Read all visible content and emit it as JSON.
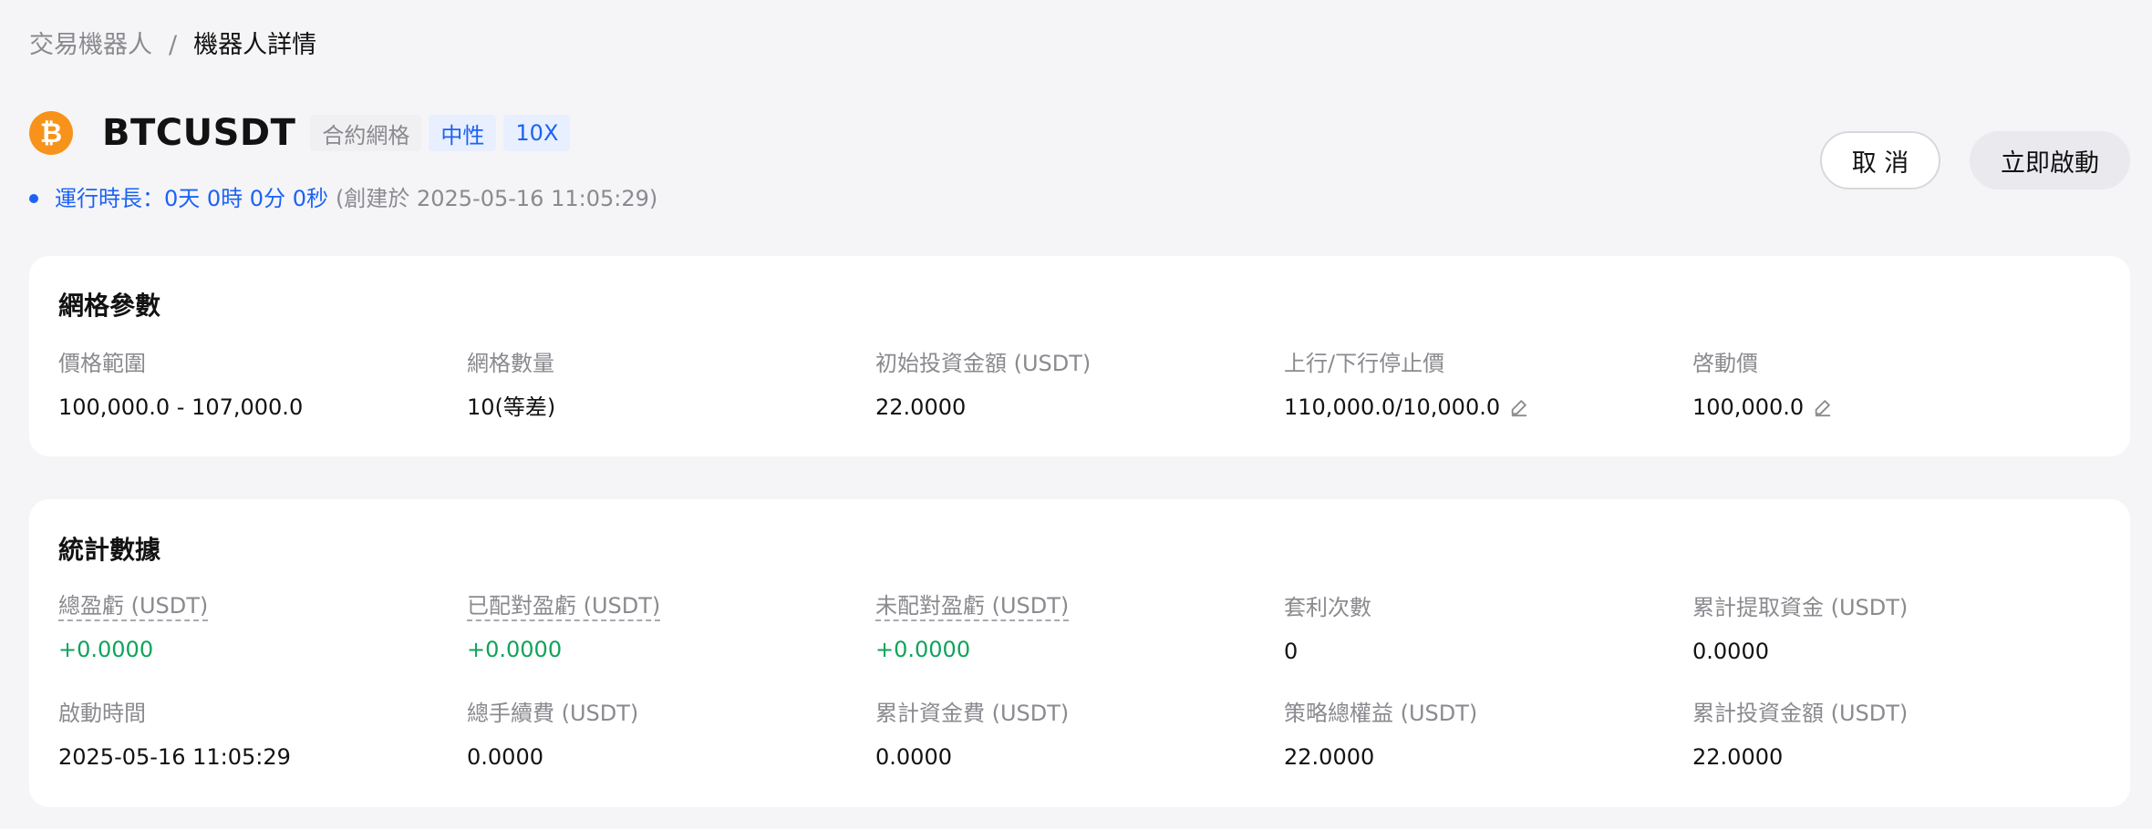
{
  "breadcrumb": {
    "parent": "交易機器人",
    "separator": "/",
    "current": "機器人詳情"
  },
  "header": {
    "coin_glyph": "₿",
    "symbol": "BTCUSDT",
    "tags": [
      "合約網格",
      "中性",
      "10X"
    ]
  },
  "runtime": {
    "label": "運行時長：",
    "value": "0天 0時 0分 0秒",
    "created": "(創建於 2025-05-16 11:05:29)"
  },
  "buttons": {
    "cancel": "取 消",
    "start": "立即啟動"
  },
  "grid_params": {
    "title": "網格參數",
    "fields": [
      {
        "label": "價格範圍",
        "value": "100,000.0 - 107,000.0"
      },
      {
        "label": "網格數量",
        "value": "10(等差)"
      },
      {
        "label": "初始投資金額 (USDT)",
        "value": "22.0000"
      },
      {
        "label": "上行/下行停止價",
        "value": "110,000.0/10,000.0"
      },
      {
        "label": "啓動價",
        "value": "100,000.0"
      }
    ]
  },
  "stats": {
    "title": "統計數據",
    "fields": [
      {
        "label": "總盈虧 (USDT)",
        "value": "+0.0000"
      },
      {
        "label": "已配對盈虧 (USDT)",
        "value": "+0.0000"
      },
      {
        "label": "未配對盈虧 (USDT)",
        "value": "+0.0000"
      },
      {
        "label": "套利次數",
        "value": "0"
      },
      {
        "label": "累計提取資金 (USDT)",
        "value": "0.0000"
      },
      {
        "label": "啟動時間",
        "value": "2025-05-16 11:05:29"
      },
      {
        "label": "總手續費 (USDT)",
        "value": "0.0000"
      },
      {
        "label": "累計資金費 (USDT)",
        "value": "0.0000"
      },
      {
        "label": "策略總權益 (USDT)",
        "value": "22.0000"
      },
      {
        "label": "累計投資金額 (USDT)",
        "value": "22.0000"
      }
    ]
  },
  "colors": {
    "accent_blue": "#1c62f5",
    "profit_green": "#0fa35b",
    "btc_orange": "#f7931a"
  }
}
